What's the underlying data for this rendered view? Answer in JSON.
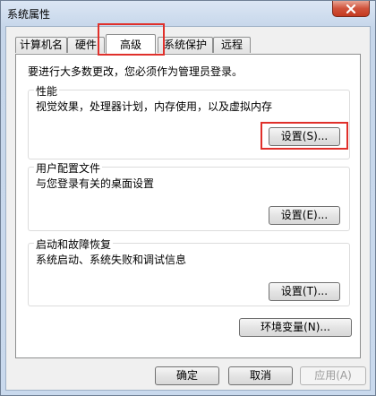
{
  "window": {
    "title": "系统属性",
    "close_icon": "×"
  },
  "tabs": [
    {
      "label": "计算机名",
      "active": false
    },
    {
      "label": "硬件",
      "active": false
    },
    {
      "label": "高级",
      "active": true
    },
    {
      "label": "系统保护",
      "active": false
    },
    {
      "label": "远程",
      "active": false
    }
  ],
  "notice": "要进行大多数更改，您必须作为管理员登录。",
  "performance": {
    "title": "性能",
    "desc": "视觉效果，处理器计划，内存使用，以及虚拟内存",
    "button": "设置(S)..."
  },
  "user_profiles": {
    "title": "用户配置文件",
    "desc": "与您登录有关的桌面设置",
    "button": "设置(E)..."
  },
  "startup_recovery": {
    "title": "启动和故障恢复",
    "desc": "系统启动、系统失败和调试信息",
    "button": "设置(T)..."
  },
  "env_button": "环境变量(N)...",
  "footer": {
    "ok": "确定",
    "cancel": "取消",
    "apply": "应用(A)"
  },
  "colors": {
    "highlight": "#e0302b",
    "close_button": "#c43a20"
  }
}
